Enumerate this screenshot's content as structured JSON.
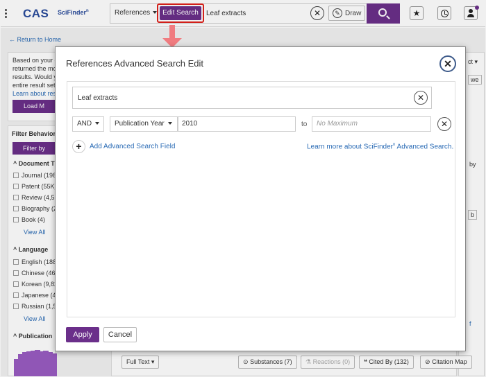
{
  "header": {
    "logo": "CAS",
    "logo_sub": "SciFinder",
    "logo_sub_mark": "n",
    "search_type": "References",
    "edit_search_label": "Edit Search",
    "query": "Leaf extracts",
    "draw_label": "Draw"
  },
  "background": {
    "return_link": "Return to Home",
    "info_lines": [
      "Based on your c",
      "returned the mo",
      "results. Would y",
      "entire result set"
    ],
    "info_link": "Learn about res",
    "load_button": "Load M",
    "filter_behavior": "Filter Behavior",
    "filter_by": "Filter by",
    "doc_type_heading": "Document T",
    "doc_types": [
      "Journal (198",
      "Patent (55K)",
      "Review (4,51",
      "Biography (2",
      "Book (4)"
    ],
    "view_all_1": "View All",
    "language_heading": "Language",
    "languages": [
      "English (188",
      "Chinese (46",
      "Korean (9,82",
      "Japanese (4,",
      "Russian (1,5"
    ],
    "view_all_2": "View All",
    "publication_heading": "Publication",
    "histogram": [
      0.55,
      0.72,
      0.78,
      0.8,
      0.82,
      0.85,
      0.8,
      0.82,
      0.78,
      0.74
    ],
    "right_fragments": [
      "ct",
      "we",
      "by",
      "b",
      "f"
    ],
    "full_text": "Full Text",
    "substances": "Substances (7)",
    "reactions": "Reactions (0)",
    "cited_by": "Cited By (132)",
    "citation_map": "Citation Map"
  },
  "modal": {
    "title": "References Advanced Search Edit",
    "query": "Leaf extracts",
    "boolean": "AND",
    "field": "Publication Year",
    "from_value": "2010",
    "to_label": "to",
    "to_placeholder": "No Maximum",
    "add_field": "Add Advanced Search Field",
    "learn_more": "Learn more about SciFinder",
    "learn_more_mark": "n",
    "learn_more_tail": " Advanced Search.",
    "apply": "Apply",
    "cancel": "Cancel"
  },
  "colors": {
    "brand": "#6b2f8a",
    "link": "#2a6bb5",
    "logo": "#2a4c9c",
    "highlight": "#e0231c",
    "arrow": "#f07c80"
  }
}
